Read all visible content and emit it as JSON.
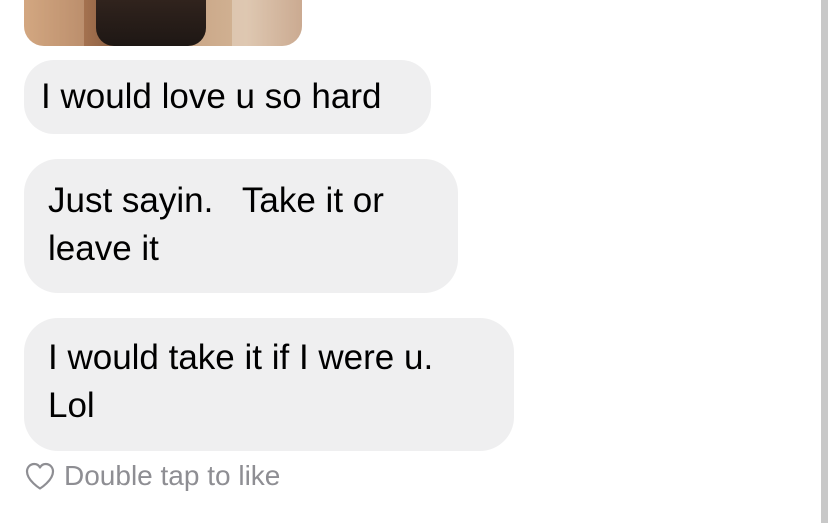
{
  "messages": [
    {
      "text": "I would love u so hard"
    },
    {
      "text": "Just sayin.   Take it or\nleave it"
    },
    {
      "text": "I would take it if I were u.\nLol"
    }
  ],
  "reaction": {
    "icon": "heart-outline-icon",
    "label": "Double tap to like"
  },
  "colors": {
    "bubble_bg": "#efeff0",
    "text": "#000000",
    "secondary_text": "#8e8e93",
    "background": "#ffffff"
  }
}
